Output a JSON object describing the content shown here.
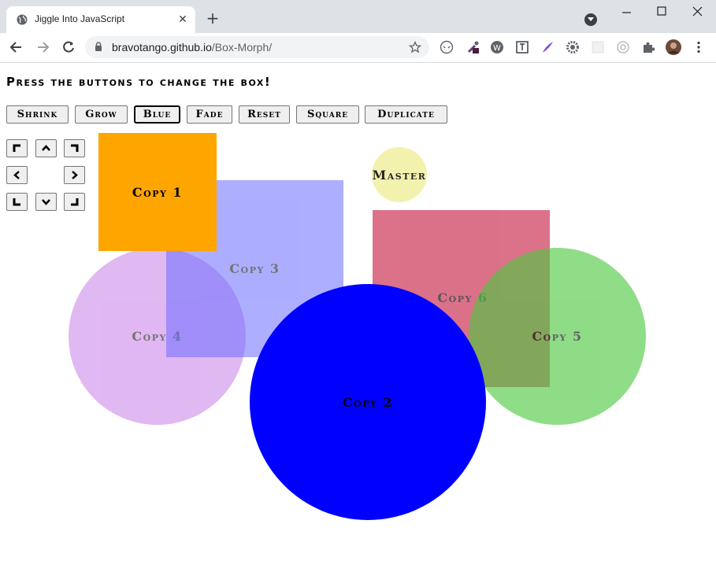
{
  "browser": {
    "tab_title": "Jiggle Into JavaScript",
    "url_host": "bravotango.github.io",
    "url_path": "/Box-Morph/"
  },
  "page": {
    "heading": "Press the buttons to change the box!",
    "buttons": [
      "Shrink",
      "Grow",
      "Blue",
      "Fade",
      "Reset",
      "Square",
      "Duplicate"
    ],
    "focused_button": "Blue"
  },
  "shapes": {
    "copy4": {
      "label": "Copy 4",
      "color": "#c77ee8",
      "opacity": 0.55,
      "shape": "circle"
    },
    "copy3": {
      "label": "Copy 3",
      "color": "#6b6bff",
      "opacity": 0.55,
      "shape": "square"
    },
    "copy1": {
      "label": "Copy 1",
      "color": "#ffa500",
      "opacity": 1,
      "shape": "square"
    },
    "master": {
      "label": "Master",
      "color": "#f0f0a0",
      "opacity": 0.85,
      "shape": "circle"
    },
    "copy6": {
      "label": "Copy 6",
      "color": "#c9264a",
      "opacity": 0.65,
      "shape": "square"
    },
    "copy5": {
      "label": "Copy 5",
      "color": "#4cc83f",
      "opacity": 0.62,
      "shape": "circle"
    },
    "copy2": {
      "label": "Copy 2",
      "color": "#0000ff",
      "opacity": 1,
      "shape": "circle"
    }
  },
  "icons": {
    "favicon": "globe-icon",
    "arrows": [
      "arrow-up-left-icon",
      "arrow-up-icon",
      "arrow-up-right-icon",
      "arrow-left-icon",
      "arrow-right-icon",
      "arrow-down-left-icon",
      "arrow-down-icon",
      "arrow-down-right-icon"
    ]
  }
}
